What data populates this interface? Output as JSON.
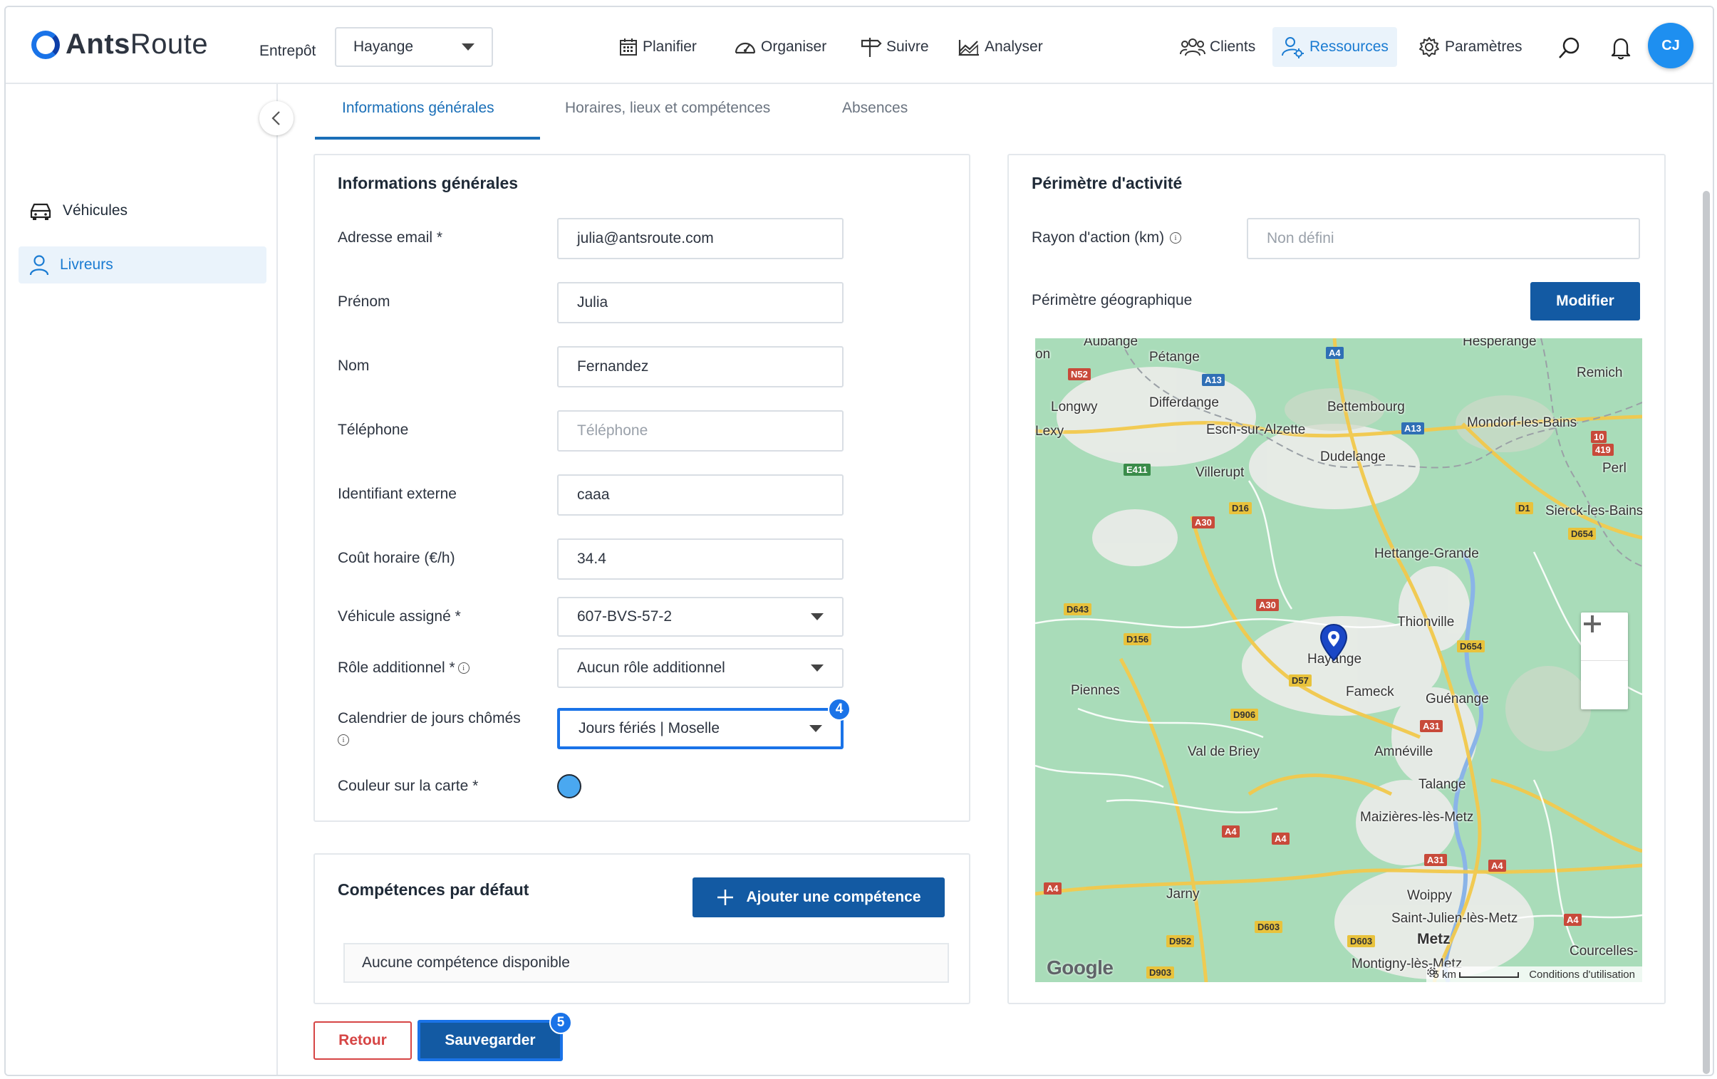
{
  "header": {
    "brand_a": "Ants",
    "brand_b": "Route",
    "warehouse_label": "Entrepôt",
    "warehouse_value": "Hayange",
    "nav": {
      "plan": "Planifier",
      "organize": "Organiser",
      "track": "Suivre",
      "analyze": "Analyser",
      "clients": "Clients",
      "resources": "Ressources",
      "settings": "Paramètres"
    },
    "avatar_initials": "CJ"
  },
  "sidebar": {
    "vehicles": "Véhicules",
    "drivers": "Livreurs"
  },
  "tabs": {
    "general": "Informations générales",
    "hours": "Horaires, lieux et compétences",
    "absences": "Absences"
  },
  "general_info": {
    "title": "Informations générales",
    "email_label": "Adresse email *",
    "email_value": "julia@antsroute.com",
    "firstname_label": "Prénom",
    "firstname_value": "Julia",
    "lastname_label": "Nom",
    "lastname_value": "Fernandez",
    "phone_label": "Téléphone",
    "phone_placeholder": "Téléphone",
    "external_id_label": "Identifiant externe",
    "external_id_value": "caaa",
    "hourly_cost_label": "Coût horaire (€/h)",
    "hourly_cost_value": "34.4",
    "vehicle_label": "Véhicule assigné *",
    "vehicle_value": "607-BVS-57-2",
    "role_label": "Rôle additionnel *",
    "role_value": "Aucun rôle additionnel",
    "calendar_label": "Calendrier de jours chômés",
    "calendar_value": "Jours fériés | Moselle",
    "color_label": "Couleur sur la carte *",
    "color_value": "#4aa8f0",
    "step_badge_calendar": "4"
  },
  "skills": {
    "title": "Compétences par défaut",
    "add_button": "Ajouter une compétence",
    "empty_text": "Aucune compétence disponible"
  },
  "perimeter": {
    "title": "Périmètre d'activité",
    "radius_label": "Rayon d'action (km)",
    "radius_placeholder": "Non défini",
    "geo_label": "Périmètre géographique",
    "modify_button": "Modifier"
  },
  "map": {
    "places": {
      "aubange": "Aubange",
      "petange": "Pétange",
      "hesperange": "Hesperange",
      "remich": "Remich",
      "longwy": "Longwy",
      "lexy": "Lexy",
      "differdange": "Differdange",
      "bettembourg": "Bettembourg",
      "esch": "Esch-sur-Alzette",
      "mondorf": "Mondorf-les-Bains",
      "dudelange": "Dudelange",
      "villerupt": "Villerupt",
      "perl": "Perl",
      "sierck": "Sierck-les-Bains",
      "hettange": "Hettange-Grande",
      "thionville": "Thionville",
      "hayange": "Hayange",
      "piennes": "Piennes",
      "fameck": "Fameck",
      "guenange": "Guénange",
      "valdebriey": "Val de Briey",
      "amneville": "Amnéville",
      "talange": "Talange",
      "maizieres": "Maizières-lès-Metz",
      "jarny": "Jarny",
      "woippy": "Woippy",
      "saintjulien": "Saint-Julien-lès-Metz",
      "metz": "Metz",
      "courcelles": "Courcelles-",
      "montigny": "Montigny-lès-Metz",
      "on": "on"
    },
    "scale": "5 km",
    "terms": "Conditions d'utilisation",
    "google": "Google"
  },
  "footer": {
    "back_button": "Retour",
    "save_button": "Sauvegarder",
    "step_badge_save": "5"
  }
}
